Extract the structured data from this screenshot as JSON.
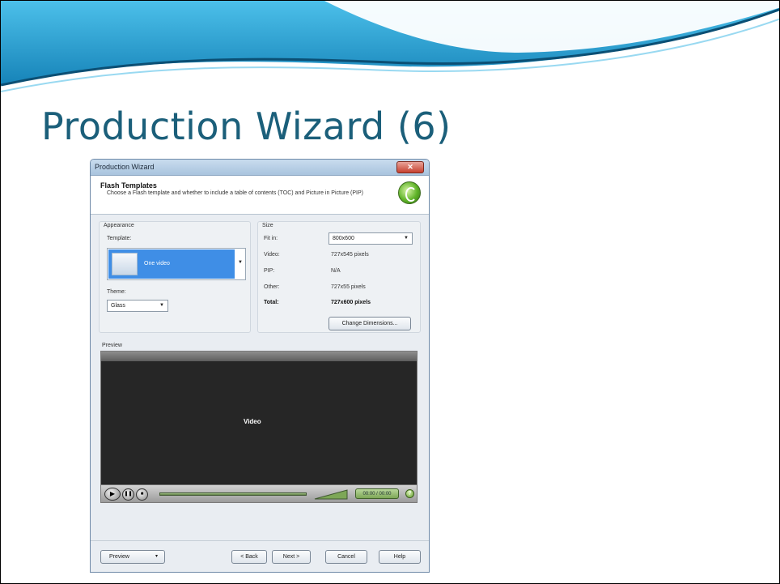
{
  "slide": {
    "title": "Production Wizard (6)",
    "accent_color": "#1b5f7a"
  },
  "window": {
    "title": "Production Wizard",
    "close_glyph": "✕"
  },
  "header": {
    "title": "Flash Templates",
    "description": "Choose a Flash template and whether to include a table of contents (TOC) and Picture in Picture (PIP)",
    "logo_icon": "camtasia-logo-icon"
  },
  "appearance": {
    "group_label": "Appearance",
    "template_label": "Template:",
    "template_selected": "One video",
    "theme_label": "Theme:",
    "theme_value": "Glass"
  },
  "size": {
    "group_label": "Size",
    "fit_in_label": "Fit in:",
    "fit_in_value": "800x600",
    "video_label": "Video:",
    "video_value": "727x545 pixels",
    "pip_label": "PIP:",
    "pip_value": "N/A",
    "other_label": "Other:",
    "other_value": "727x55 pixels",
    "total_label": "Total:",
    "total_value": "727x600 pixels",
    "change_button": "Change Dimensions..."
  },
  "preview": {
    "label": "Preview",
    "video_label": "Video",
    "time": "00:00 / 00:00",
    "help_glyph": "?"
  },
  "footer": {
    "preview_button": "Preview",
    "back_button": "< Back",
    "next_button": "Next >",
    "cancel_button": "Cancel",
    "help_button": "Help"
  }
}
